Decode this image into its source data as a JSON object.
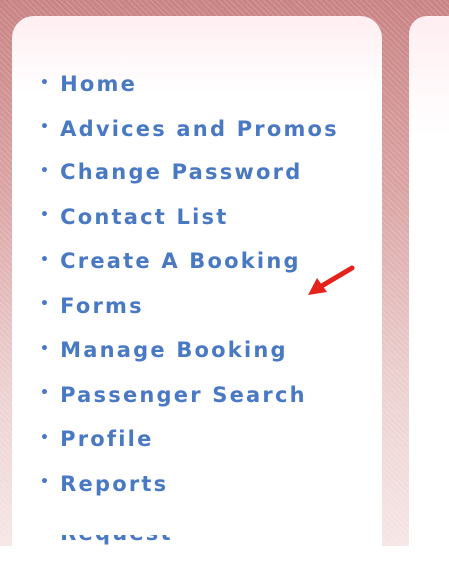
{
  "menu": {
    "bullet": "•",
    "items": [
      {
        "label": "Home"
      },
      {
        "label": "Advices and Promos"
      },
      {
        "label": "Change Password"
      },
      {
        "label": "Contact List"
      },
      {
        "label": "Create A Booking"
      },
      {
        "label": "Forms"
      },
      {
        "label": "Manage Booking"
      },
      {
        "label": "Passenger Search"
      },
      {
        "label": "Profile"
      },
      {
        "label": "Reports"
      }
    ],
    "partial_item": "Request"
  },
  "annotation": {
    "icon": "red-arrow-icon",
    "color": "#e4221b"
  },
  "colors": {
    "link": "#4a79c4",
    "frame": "#d89a9a"
  }
}
